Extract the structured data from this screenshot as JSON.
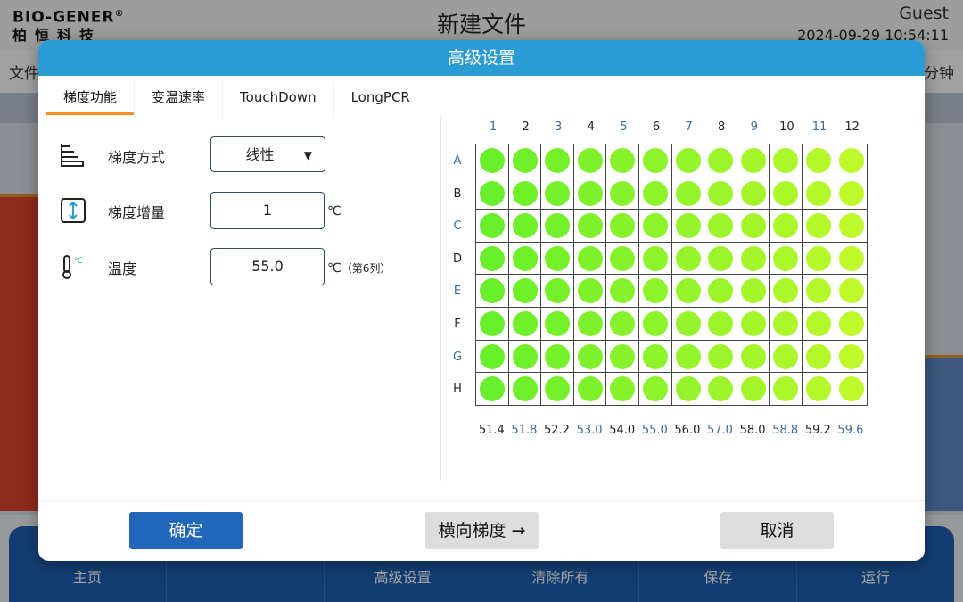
{
  "app": {
    "logo_en": "BIO-GENER",
    "logo_reg": "®",
    "logo_cn": "柏恒科技",
    "title": "新建文件",
    "user": "Guest",
    "datetime": "2024-09-29 10:54:11",
    "bg_left_text": "文件",
    "bg_right_text": "分钟",
    "nav": [
      "主页",
      "",
      "高级设置",
      "清除所有",
      "保存",
      "运行"
    ]
  },
  "dialog": {
    "title": "高级设置",
    "tabs": [
      "梯度功能",
      "变温速率",
      "TouchDown",
      "LongPCR"
    ],
    "active_tab": 0,
    "fields": {
      "mode": {
        "label": "梯度方式",
        "value": "线性",
        "icon": "gradient-steps-icon"
      },
      "increment": {
        "label": "梯度增量",
        "value": "1",
        "unit": "℃",
        "icon": "vertical-range-icon"
      },
      "temperature": {
        "label": "温度",
        "value": "55.0",
        "unit": "℃",
        "unit_note": "（第6列）",
        "icon": "thermometer-icon"
      }
    },
    "plate": {
      "columns": [
        "1",
        "2",
        "3",
        "4",
        "5",
        "6",
        "7",
        "8",
        "9",
        "10",
        "11",
        "12"
      ],
      "rows": [
        "A",
        "B",
        "C",
        "D",
        "E",
        "F",
        "G",
        "H"
      ],
      "column_temps": [
        "51.4",
        "51.8",
        "52.2",
        "53.0",
        "54.0",
        "55.0",
        "56.0",
        "57.0",
        "58.0",
        "58.8",
        "59.2",
        "59.6"
      ],
      "well_colors": [
        "#69ee2b",
        "#70ef2b",
        "#76f02b",
        "#7ef12b",
        "#85f22b",
        "#8df32b",
        "#95f42b",
        "#9cf52b",
        "#a4f62b",
        "#acf72b",
        "#b4f82b",
        "#bdf92b"
      ]
    },
    "buttons": {
      "confirm": "确定",
      "horizontal_gradient": "横向梯度 →",
      "cancel": "取消"
    },
    "colors": {
      "header": "#2a9bd3",
      "confirm": "#2266b9",
      "tab_underline": "#f0941f"
    }
  }
}
